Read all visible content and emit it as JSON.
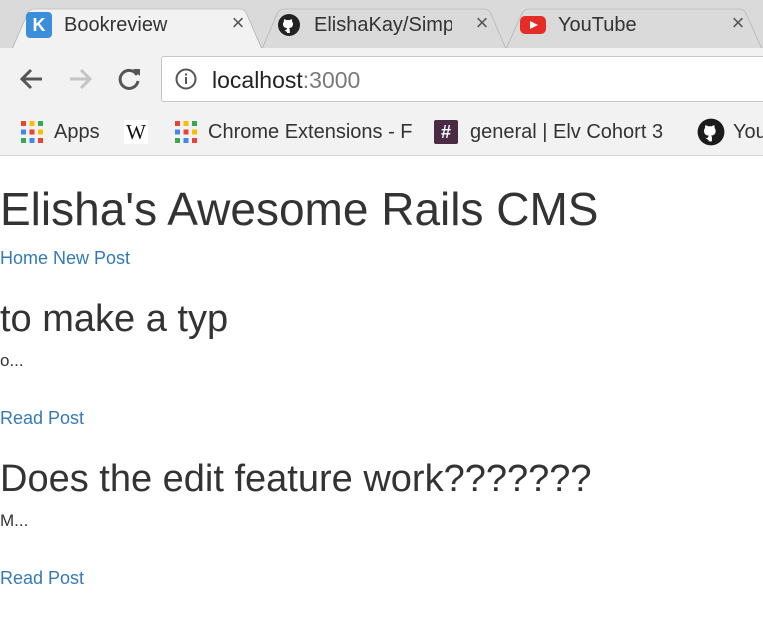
{
  "browser": {
    "tabs": [
      {
        "title": "Bookreview",
        "favicon": "k-logo-icon",
        "active": true
      },
      {
        "title": "ElishaKay/Simp",
        "favicon": "github-icon",
        "active": false
      },
      {
        "title": "YouTube",
        "favicon": "youtube-icon",
        "active": false
      }
    ],
    "url_host": "localhost",
    "url_port": ":3000",
    "bookmarks": [
      {
        "label": "Apps",
        "icon": "apps-grid-icon"
      },
      {
        "label": "",
        "icon": "wikipedia-icon"
      },
      {
        "label": "Chrome Extensions - F",
        "icon": "apps-grid-icon"
      },
      {
        "label": "general | Elv Cohort 3",
        "icon": "slack-icon"
      },
      {
        "label": "You",
        "icon": "github-icon"
      }
    ]
  },
  "site": {
    "title": "Elisha's Awesome Rails CMS",
    "nav": {
      "home": "Home",
      "new_post": "New Post"
    }
  },
  "posts": [
    {
      "title": "to make a typ",
      "excerpt": "o...",
      "link": "Read Post"
    },
    {
      "title": "Does the edit feature work???????",
      "excerpt": "M...",
      "link": "Read Post"
    }
  ],
  "colors": {
    "link": "#337ab7",
    "text": "#333333"
  }
}
